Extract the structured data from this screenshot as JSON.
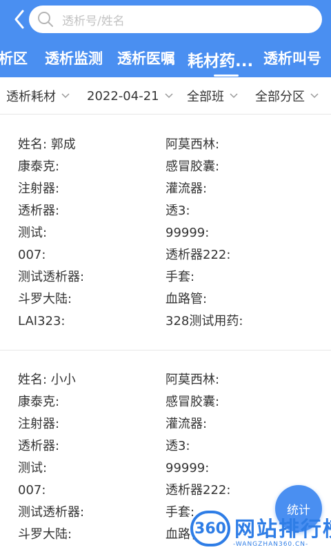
{
  "header": {
    "search_placeholder": "透析号/姓名",
    "tabs": [
      {
        "label": "析区"
      },
      {
        "label": "透析监测"
      },
      {
        "label": "透析医嘱"
      },
      {
        "label": "耗材药..."
      },
      {
        "label": "透析叫号"
      }
    ],
    "active_tab": "耗材药..."
  },
  "filters": [
    {
      "label": "透析耗材"
    },
    {
      "label": "2022-04-21"
    },
    {
      "label": "全部班"
    },
    {
      "label": "全部分区"
    }
  ],
  "patients": [
    {
      "left": [
        "姓名: 郭成",
        "康泰克:",
        "注射器:",
        "透析器:",
        "测试:",
        "007:",
        "测试透析器:",
        "斗罗大陆:",
        "LAI323:"
      ],
      "right": [
        "阿莫西林:",
        "感冒胶囊:",
        "灌流器:",
        "透3:",
        "99999:",
        "透析器222:",
        "手套:",
        "血路管:",
        "328测试用药:"
      ]
    },
    {
      "left": [
        "姓名: 小小",
        "康泰克:",
        "注射器:",
        "透析器:",
        "测试:",
        "007:",
        "测试透析器:",
        "斗罗大陆:"
      ],
      "right": [
        "阿莫西林:",
        "感冒胶囊:",
        "灌流器:",
        "透3:",
        "99999:",
        "透析器222:",
        "手套:",
        "血路管:"
      ]
    }
  ],
  "stat_button": {
    "label": "统计"
  },
  "watermark": {
    "logo": "360",
    "title": "网站排行榜",
    "subtitle": "-WANGZHAN360.CN-"
  },
  "colors": {
    "primary": "#4a8ff1",
    "text": "#333333",
    "placeholder": "#c3c3c3"
  }
}
